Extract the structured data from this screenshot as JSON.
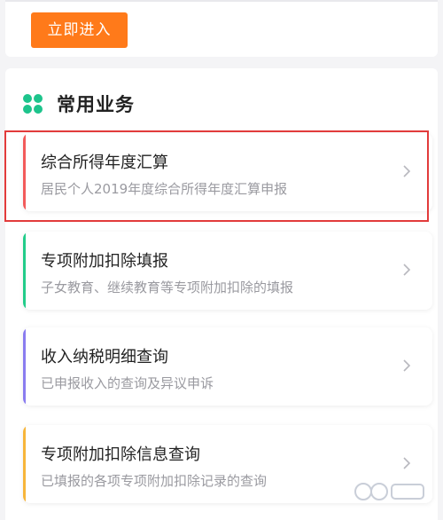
{
  "top": {
    "enter_label": "立即进入"
  },
  "section": {
    "title": "常用业务",
    "icon": "grid-dots-icon",
    "accent_color": "#1dc48c"
  },
  "services": [
    {
      "title": "综合所得年度汇算",
      "subtitle": "居民个人2019年度综合所得年度汇算申报",
      "accent": "#f25b5b",
      "highlighted": true
    },
    {
      "title": "专项附加扣除填报",
      "subtitle": "子女教育、继续教育等专项附加扣除的填报",
      "accent": "#22cc8a",
      "highlighted": false
    },
    {
      "title": "收入纳税明细查询",
      "subtitle": "已申报收入的查询及异议申诉",
      "accent": "#8a7cf0",
      "highlighted": false
    },
    {
      "title": "专项附加扣除信息查询",
      "subtitle": "已填报的各项专项附加扣除记录的查询",
      "accent": "#f7b53a",
      "highlighted": false
    }
  ],
  "colors": {
    "brand_orange": "#ff7a1a",
    "highlight_red": "#e23b3b"
  }
}
